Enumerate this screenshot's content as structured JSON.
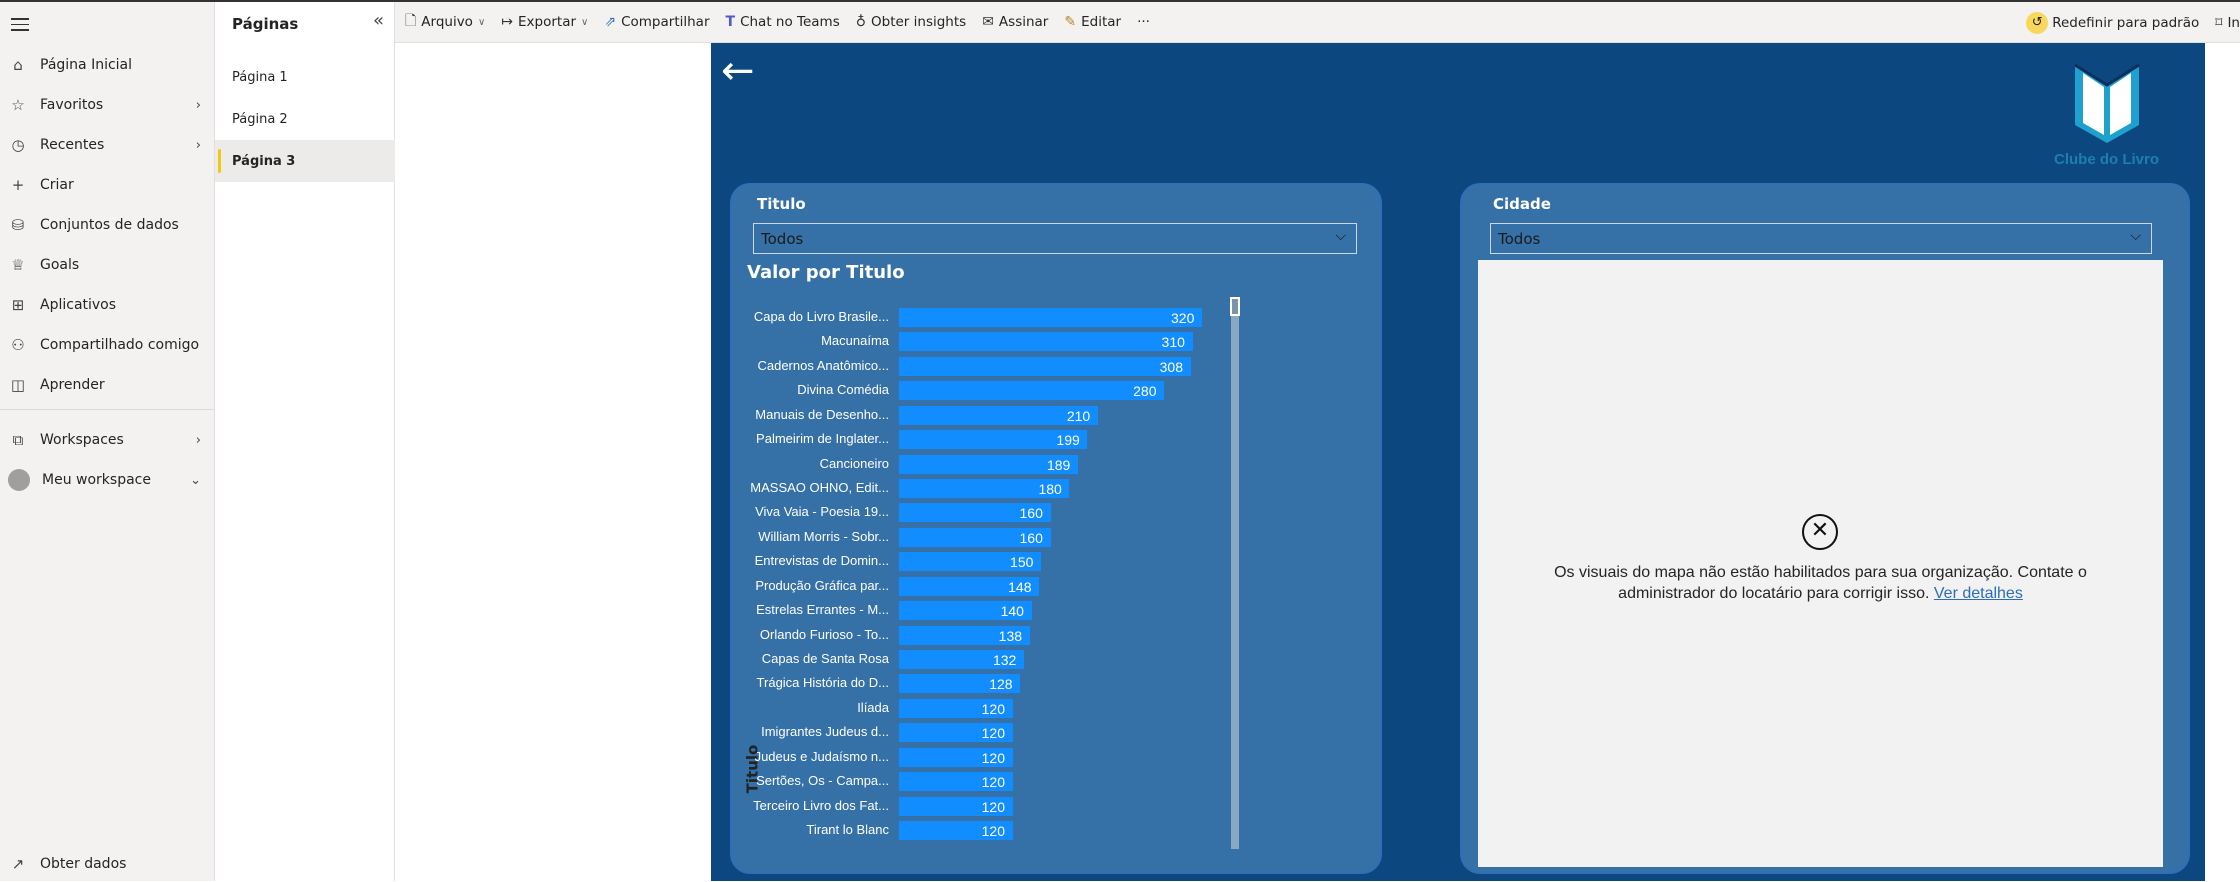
{
  "nav": {
    "items": [
      {
        "label": "Página Inicial",
        "icon": "home-icon",
        "glyph": "⌂"
      },
      {
        "label": "Favoritos",
        "icon": "star-icon",
        "glyph": "☆",
        "chevron": true
      },
      {
        "label": "Recentes",
        "icon": "clock-icon",
        "glyph": "◷",
        "chevron": true
      },
      {
        "label": "Criar",
        "icon": "plus-icon",
        "glyph": "+"
      },
      {
        "label": "Conjuntos de dados",
        "icon": "database-icon",
        "glyph": "⛁"
      },
      {
        "label": "Goals",
        "icon": "trophy-icon",
        "glyph": "♕"
      },
      {
        "label": "Aplicativos",
        "icon": "apps-icon",
        "glyph": "⊞"
      },
      {
        "label": "Compartilhado comigo",
        "icon": "shared-icon",
        "glyph": "⚇"
      },
      {
        "label": "Aprender",
        "icon": "book-icon",
        "glyph": "◫"
      }
    ],
    "workspaces": "Workspaces",
    "my_workspace": "Meu workspace",
    "get_data": "Obter dados"
  },
  "pages": {
    "title": "Páginas",
    "items": [
      "Página 1",
      "Página 2",
      "Página 3"
    ],
    "selected": 2
  },
  "toolbar": {
    "file": "Arquivo",
    "export": "Exportar",
    "share": "Compartilhar",
    "teams": "Chat no Teams",
    "insights": "Obter insights",
    "subscribe": "Assinar",
    "edit": "Editar",
    "more": "···",
    "reset": "Redefinir para padrão",
    "bookmark": "In"
  },
  "report": {
    "logo_text": "Clube do Livro",
    "title_slicer": {
      "label": "Titulo",
      "value": "Todos"
    },
    "city_slicer": {
      "label": "Cidade",
      "value": "Todos"
    },
    "map_error": {
      "line1": "Os visuais do mapa não estão habilitados para sua organização. Contate o",
      "line2": "administrador do locatário para corrigir isso.",
      "link": "Ver detalhes"
    },
    "colors": {
      "background": "#0c487f",
      "panel": "#3570a6",
      "bar": "#118dff"
    }
  },
  "chart_data": {
    "type": "bar",
    "orientation": "horizontal",
    "title": "Valor por Titulo",
    "ylabel": "Titulo",
    "xlabel": "",
    "categories": [
      "Capa do Livro Brasile...",
      "Macunaíma",
      "Cadernos Anatômico...",
      "Divina Comédia",
      "Manuais de Desenho...",
      "Palmeirim de Inglater...",
      "Cancioneiro",
      "MASSAO OHNO, Edit...",
      "Viva Vaia - Poesia 19...",
      "William Morris - Sobr...",
      "Entrevistas de Domin...",
      "Produção Gráfica par...",
      "Estrelas Errantes - M...",
      "Orlando Furioso - To...",
      "Capas de Santa Rosa",
      "Trágica História do D...",
      "Ilíada",
      "Imigrantes Judeus d...",
      "Judeus e Judaísmo n...",
      "Sertões, Os - Campa...",
      "Terceiro Livro dos Fat...",
      "Tirant lo Blanc"
    ],
    "values": [
      320,
      310,
      308,
      280,
      210,
      199,
      189,
      180,
      160,
      160,
      150,
      148,
      140,
      138,
      132,
      128,
      120,
      120,
      120,
      120,
      120,
      120
    ],
    "data_labels": true,
    "grid": false,
    "xlim": [
      0,
      320
    ]
  }
}
